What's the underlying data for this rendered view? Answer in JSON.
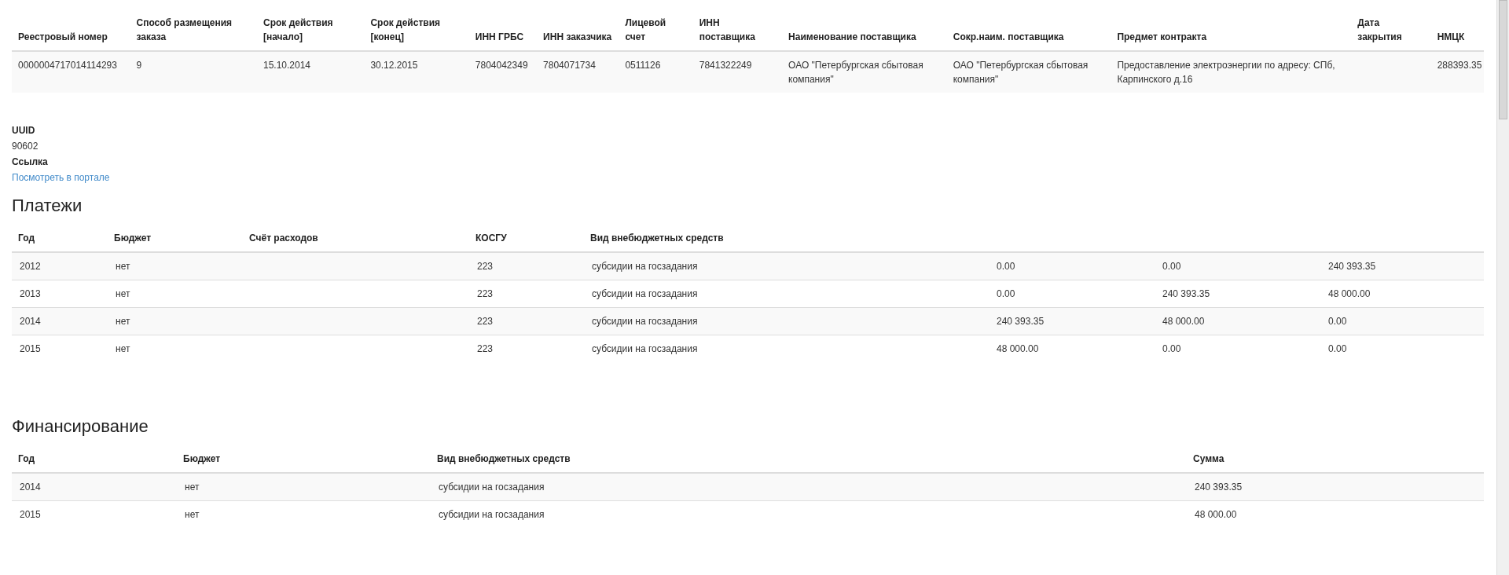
{
  "contract_table": {
    "columns": [
      "Реестровый номер",
      "Способ размещения заказа",
      "Срок действия [начало]",
      "Срок действия [конец]",
      "ИНН ГРБС",
      "ИНН заказчика",
      "Лицевой счет",
      "ИНН поставщика",
      "Наименование поставщика",
      "Сокр.наим. поставщика",
      "Предмет контракта",
      "Дата закрытия",
      "НМЦК"
    ],
    "rows": [
      [
        "0000004717014114293",
        "9",
        "15.10.2014",
        "30.12.2015",
        "7804042349",
        "7804071734",
        "0511126",
        "7841322249",
        "ОАО \"Петербургская сбытовая компания\"",
        "ОАО \"Петербургская сбытовая компания\"",
        "Предоставление электроэнергии по адресу: СПб, Карпинского д.16",
        "",
        "288393.35"
      ]
    ]
  },
  "details": [
    {
      "label": "UUID",
      "value": "90602",
      "kind": "text"
    },
    {
      "label": "Ссылка",
      "value": "Посмотреть в портале",
      "kind": "link"
    }
  ],
  "payments": {
    "title": "Платежи",
    "columns": [
      "Год",
      "Бюджет",
      "Счёт расходов",
      "КОСГУ",
      "Вид внебюджетных средств",
      "",
      "",
      ""
    ],
    "rows": [
      [
        "2012",
        "нет",
        "",
        "223",
        "субсидии на госзадания",
        "0.00",
        "0.00",
        "240 393.35"
      ],
      [
        "2013",
        "нет",
        "",
        "223",
        "субсидии на госзадания",
        "0.00",
        "240 393.35",
        "48 000.00"
      ],
      [
        "2014",
        "нет",
        "",
        "223",
        "субсидии на госзадания",
        "240 393.35",
        "48 000.00",
        "0.00"
      ],
      [
        "2015",
        "нет",
        "",
        "223",
        "субсидии на госзадания",
        "48 000.00",
        "0.00",
        "0.00"
      ]
    ]
  },
  "financing": {
    "title": "Финансирование",
    "columns": [
      "Год",
      "Бюджет",
      "Вид внебюджетных средств",
      "Сумма"
    ],
    "rows": [
      [
        "2014",
        "нет",
        "субсидии на госзадания",
        "240 393.35"
      ],
      [
        "2015",
        "нет",
        "субсидии на госзадания",
        "48 000.00"
      ]
    ]
  }
}
